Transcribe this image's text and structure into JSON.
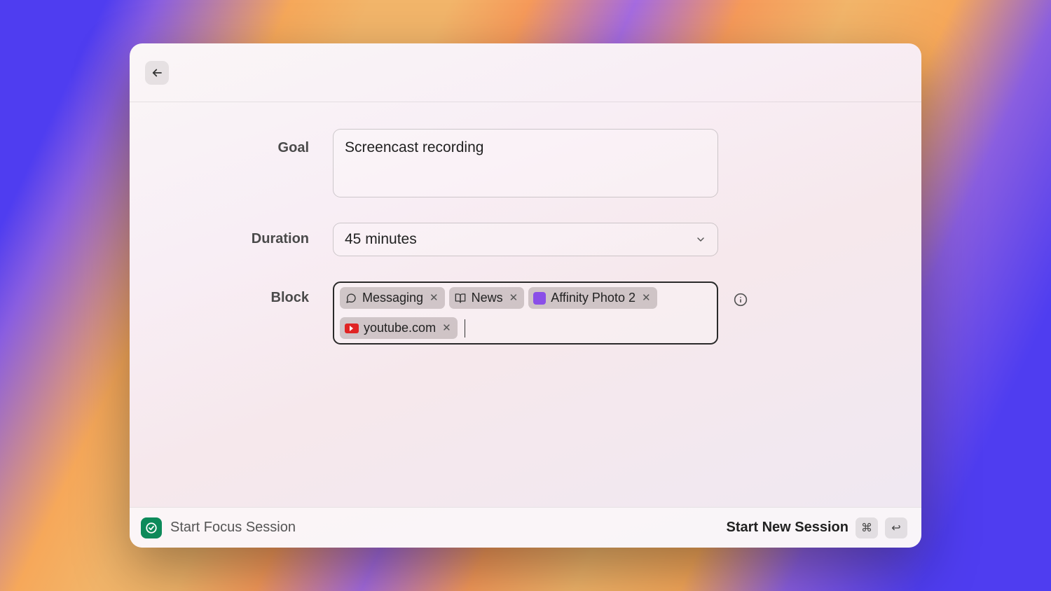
{
  "form": {
    "goal_label": "Goal",
    "goal_value": "Screencast recording",
    "duration_label": "Duration",
    "duration_value": "45 minutes",
    "block_label": "Block",
    "block_tokens": [
      {
        "label": "Messaging",
        "icon": "chat"
      },
      {
        "label": "News",
        "icon": "news"
      },
      {
        "label": "Affinity Photo 2",
        "icon": "aff"
      },
      {
        "label": "youtube.com",
        "icon": "yt"
      }
    ]
  },
  "footer": {
    "app_title": "Start Focus Session",
    "action_label": "Start New Session",
    "shortcut_cmd": "⌘",
    "shortcut_return": "↩"
  }
}
